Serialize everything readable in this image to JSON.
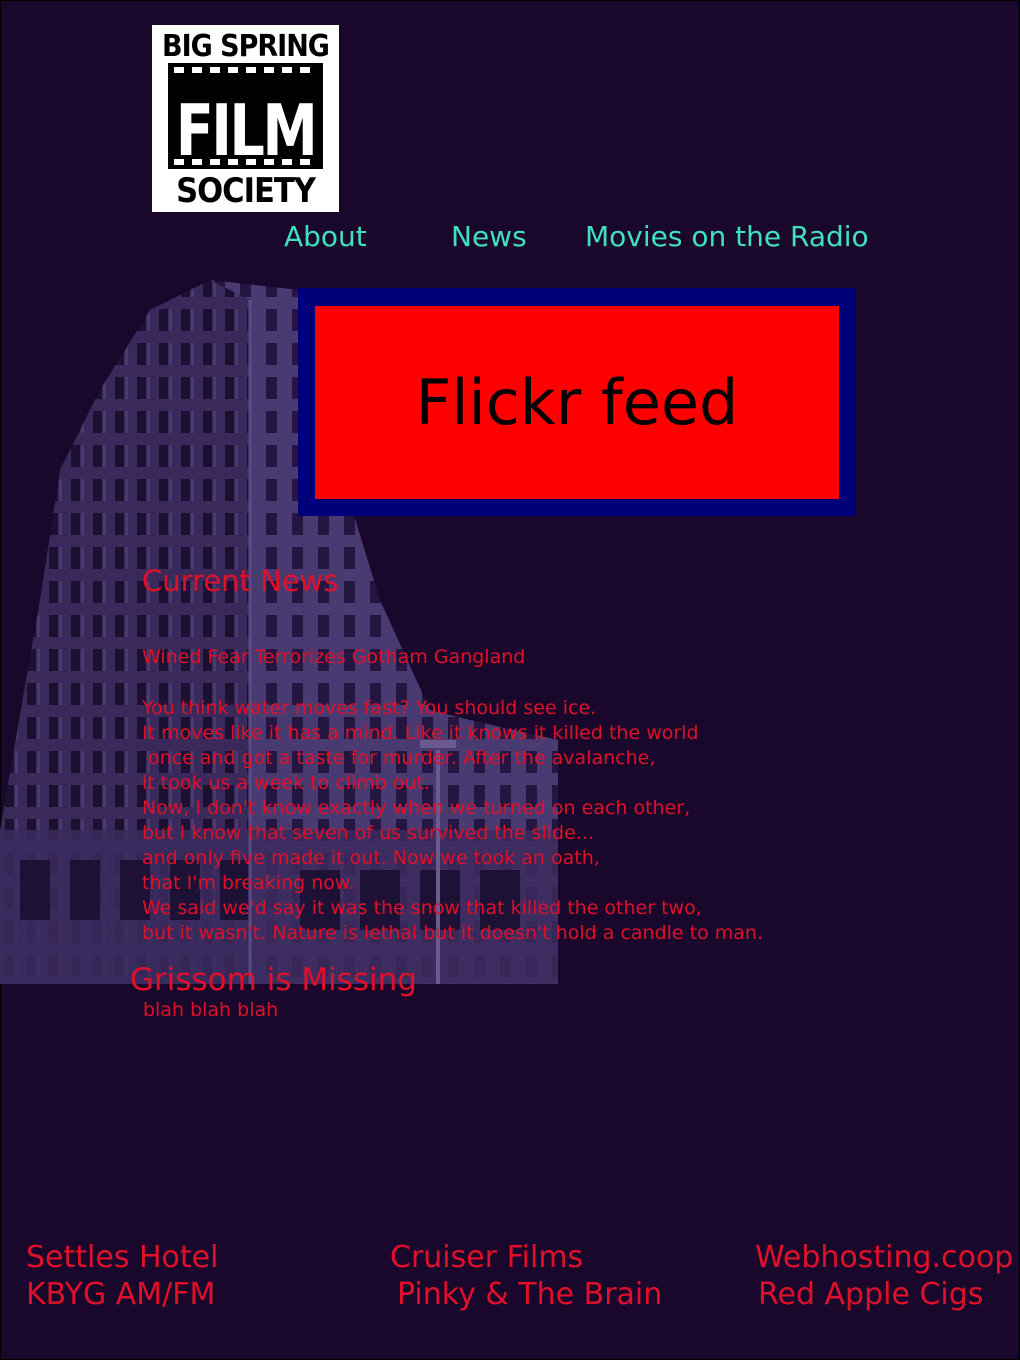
{
  "logo": {
    "line1": "BIG SPRING",
    "line2": "FILM",
    "line3": "SOCIETY"
  },
  "nav": {
    "about": "About",
    "news": "News",
    "radio": "Movies on the Radio"
  },
  "flickr": {
    "label": "Flickr feed"
  },
  "news": {
    "heading": "Current News",
    "article_title": "Wined Fear Terrorizes Gotham Gangland",
    "article_body": "You think water moves fast? You should see ice.\nIt moves like it has a mind. Like it knows it killed the world\n once and got a taste for murder. After the avalanche,\nit took us a week to climb out.\nNow, I don't know exactly when we turned on each other,\nbut I know that seven of us survived the slide...\nand only five made it out. Now we took an oath,\nthat I'm breaking now.\nWe said we'd say it was the snow that killed the other two,\nbut it wasn't. Nature is lethal but it doesn't hold a candle to man.",
    "second_heading": "Grissom is Missing",
    "second_body": "blah blah blah"
  },
  "footer": {
    "col1": [
      "Settles Hotel",
      "KBYG AM/FM"
    ],
    "col2": [
      "Cruiser Films",
      "Pinky & The Brain"
    ],
    "col3": [
      "Webhosting.coop",
      "Red Apple Cigs"
    ]
  },
  "colors": {
    "background": "#19082b",
    "nav_link": "#3ee0c0",
    "text_red": "#e0102a",
    "flickr_border": "#00007a",
    "flickr_fill": "#ff0000"
  }
}
